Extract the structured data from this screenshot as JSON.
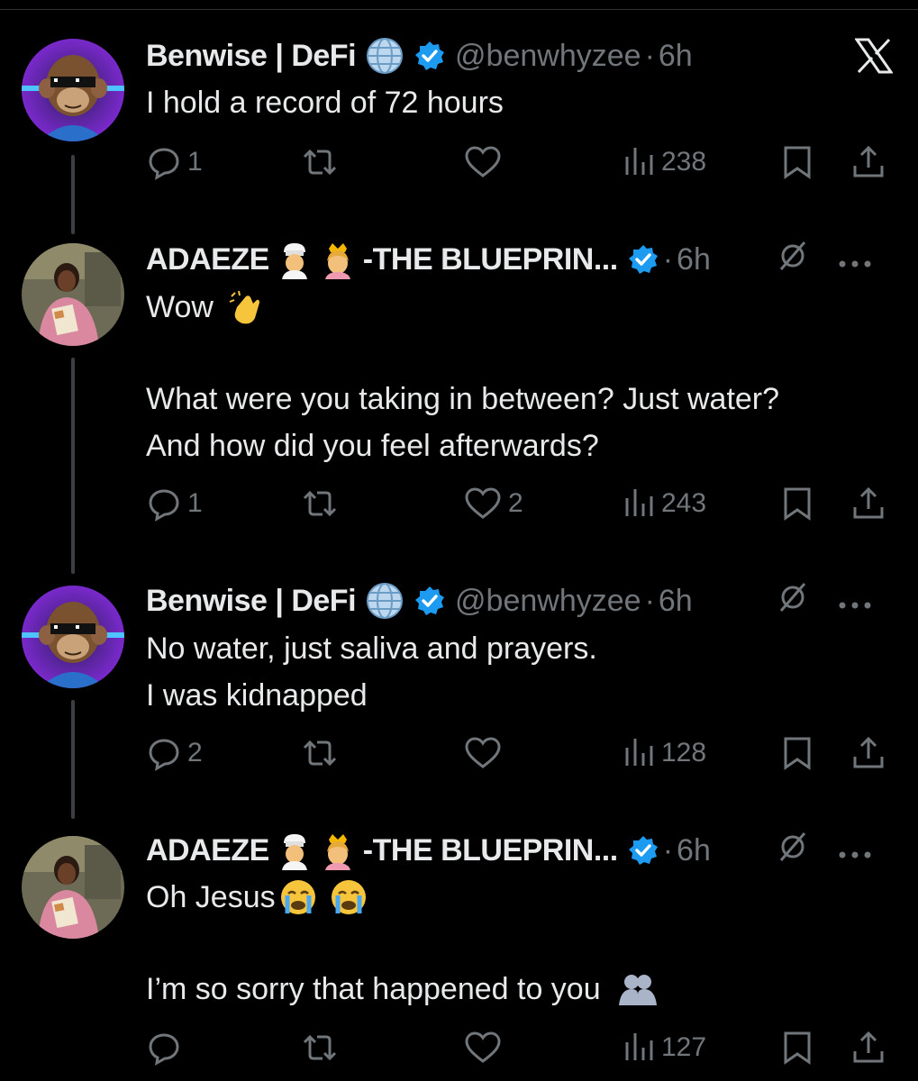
{
  "tweets": [
    {
      "name": "Benwise | DeFi",
      "handle": "@benwhyzee",
      "time": "6h",
      "lines": [
        "I hold a record of 72 hours"
      ],
      "para2": [],
      "replies": "1",
      "likes": "",
      "views": "238"
    },
    {
      "name": "ADAEZE",
      "name_suffix": "-THE BLUEPRIN...",
      "time": "6h",
      "lines": [
        "Wow"
      ],
      "para2": [
        "What were you taking in between? Just water?",
        "And how did you feel afterwards?"
      ],
      "replies": "1",
      "likes": "2",
      "views": "243"
    },
    {
      "name": "Benwise | DeFi",
      "handle": "@benwhyzee",
      "time": "6h",
      "lines": [
        "No water, just saliva and prayers.",
        "I was kidnapped"
      ],
      "para2": [],
      "replies": "2",
      "likes": "",
      "views": "128"
    },
    {
      "name": "ADAEZE",
      "name_suffix": "-THE BLUEPRIN...",
      "time": "6h",
      "lines": [
        "Oh Jesus"
      ],
      "para2": [
        "I’m so sorry that happened to you"
      ],
      "replies": "",
      "likes": "",
      "views": "127"
    }
  ],
  "separator": "·",
  "colors": {
    "background": "#000000",
    "text": "#e7e9ea",
    "muted": "#71767b",
    "verified": "#1d9bf0"
  },
  "icons": [
    "x-logo-icon",
    "globe-icon",
    "verified-badge-icon",
    "chef-emoji-icon",
    "crown-emoji-icon",
    "clapping-emoji-icon",
    "crying-emoji-icon",
    "hug-emoji-icon",
    "reply-icon",
    "retweet-icon",
    "like-icon",
    "views-icon",
    "bookmark-icon",
    "share-icon",
    "grok-icon",
    "more-icon"
  ]
}
